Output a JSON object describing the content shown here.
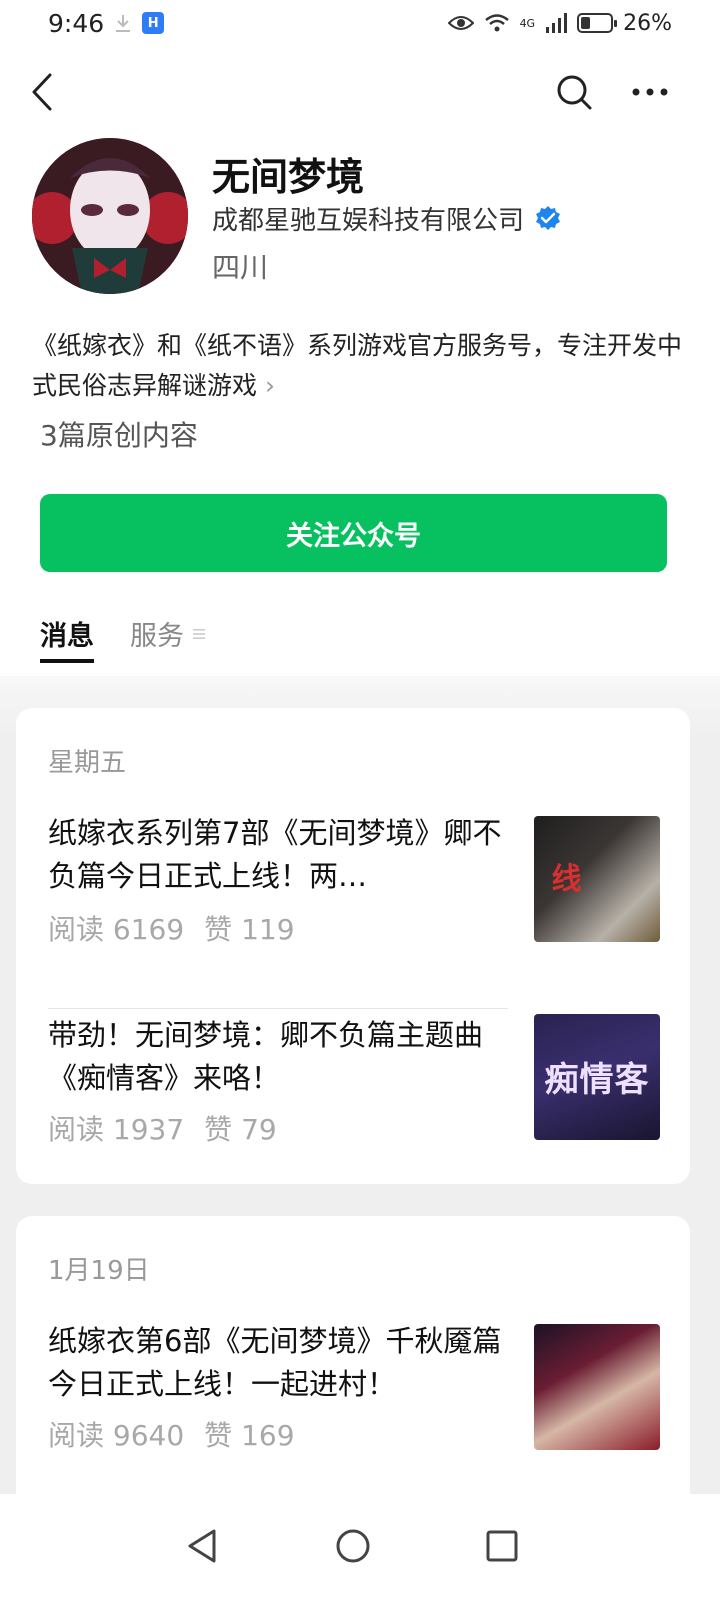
{
  "status_bar": {
    "time": "9:46",
    "network": "4G",
    "battery": "26%"
  },
  "header": {
    "icons": [
      "back-icon",
      "search-icon",
      "more-icon"
    ]
  },
  "profile": {
    "name": "无间梦境",
    "company": "成都星驰互娱科技有限公司",
    "region": "四川",
    "description": "《纸嫁衣》和《纸不语》系列游戏官方服务号，专注开发中式民俗志异解谜游戏",
    "original_count": "3篇原创内容",
    "follow_label": "关注公众号",
    "accent_color": "#07c160",
    "verified_color": "#1e84f0"
  },
  "tabs": [
    {
      "label": "消息",
      "active": true
    },
    {
      "label": "服务",
      "active": false
    }
  ],
  "feed": [
    {
      "date": "星期五",
      "articles": [
        {
          "title": "纸嫁衣系列第7部《无间梦境》卿不负篇今日正式上线！两…",
          "read_label": "阅读 6169",
          "like_label": "赞 119",
          "thumb_text": "线"
        },
        {
          "title": "带劲！无间梦境：卿不负篇主题曲《痴情客》来咯！",
          "read_label": "阅读 1937",
          "like_label": "赞 79",
          "thumb_text": "痴情客"
        }
      ]
    },
    {
      "date": "1月19日",
      "articles": [
        {
          "title": "纸嫁衣第6部《无间梦境》千秋魇篇今日正式上线！一起进村！",
          "read_label": "阅读 9640",
          "like_label": "赞 169",
          "thumb_text": ""
        }
      ]
    }
  ],
  "nav_bar": {
    "icons": [
      "nav-back-icon",
      "nav-home-icon",
      "nav-recents-icon"
    ]
  }
}
